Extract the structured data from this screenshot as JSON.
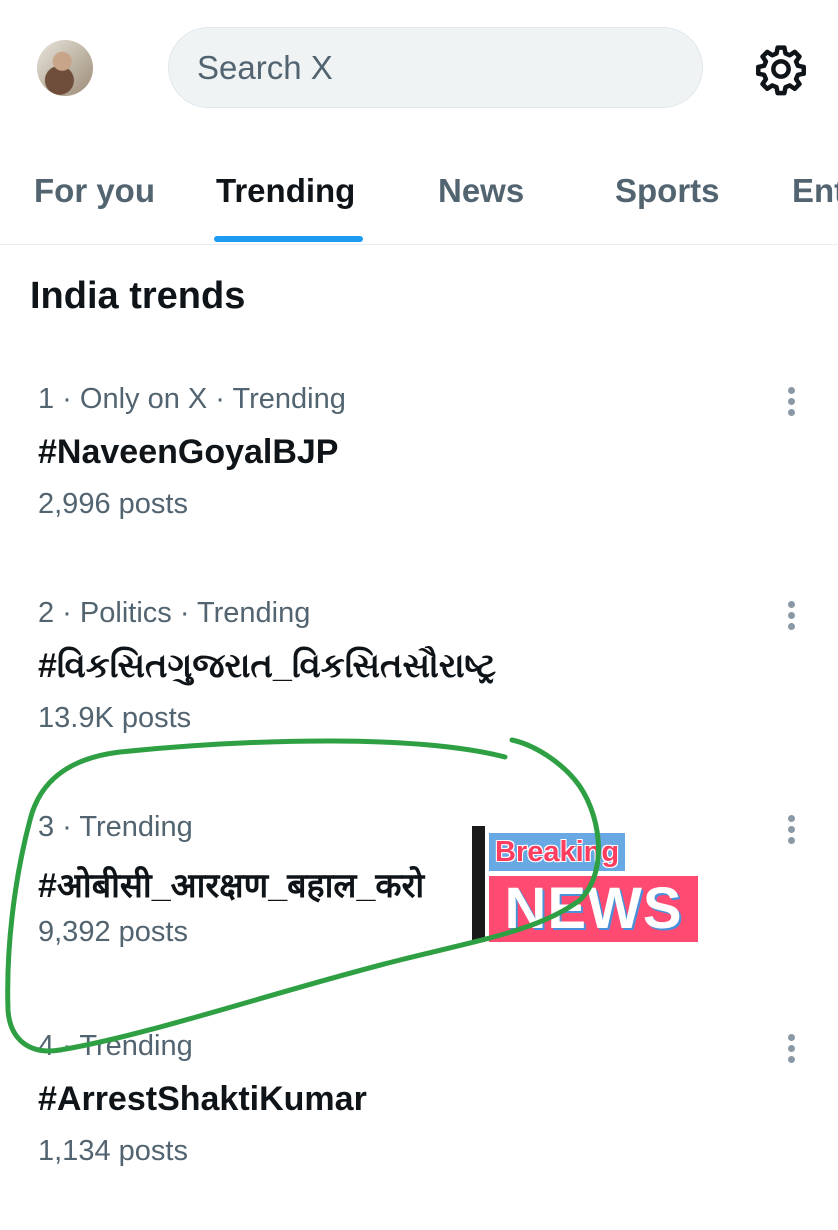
{
  "header": {
    "search_placeholder": "Search X",
    "avatar_icon": "profile-photo",
    "settings_icon": "gear-icon"
  },
  "tabs": [
    {
      "label": "For you",
      "active": false
    },
    {
      "label": "Trending",
      "active": true
    },
    {
      "label": "News",
      "active": false
    },
    {
      "label": "Sports",
      "active": false
    },
    {
      "label": "Ent",
      "active": false
    }
  ],
  "section_title": "India trends",
  "trends": [
    {
      "meta": "1 · Only on X · Trending",
      "name": "#NaveenGoyalBJP",
      "count": "2,996 posts"
    },
    {
      "meta": "2 · Politics · Trending",
      "name": "#વિકસિતગુજરાત_વિકસિતસૌરાષ્ટ્ર",
      "count": "13.9K posts"
    },
    {
      "meta": "3 · Trending",
      "name": "#ओबीसी_आरक्षण_बहाल_करो",
      "count": "9,392 posts"
    },
    {
      "meta": "4 · Trending",
      "name": "#ArrestShaktiKumar",
      "count": "1,134 posts"
    }
  ],
  "overlay": {
    "breaking_label": "Breaking",
    "news_label": "NEWS",
    "annotation_color": "#2ea043"
  },
  "colors": {
    "accent": "#1d9bf0",
    "secondary_text": "#536471",
    "primary_text": "#0f1419"
  }
}
